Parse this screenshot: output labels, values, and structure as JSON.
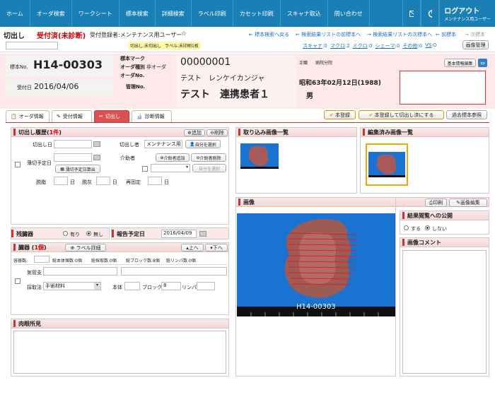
{
  "nav": {
    "items": [
      "ホーム",
      "オーダ検索",
      "ワークシート",
      "標本検索",
      "詳細検索",
      "ラベル印刷",
      "カセット印刷",
      "スキャナ取込",
      "問い合わせ"
    ],
    "logout": "ログアウト",
    "user": "メンテナンス用ユーザー"
  },
  "header": {
    "title": "切出し",
    "status": "受付済(未診断)",
    "registrant": "受付登録者:メンテナンス用ユーザー",
    "star": "☆",
    "links": [
      "標本検索へ戻る",
      "検索結果リストの前標本へ",
      "検索結果リストの次標本へ",
      "前標本",
      "次標本"
    ],
    "badge_cut": "切出し:未切出し",
    "badge_label": "ラベル:未印刷1枚",
    "counters": [
      {
        "k": "スキャナ",
        "v": "0"
      },
      {
        "k": "マクロ",
        "v": "2"
      },
      {
        "k": "ミクロ",
        "v": "0"
      },
      {
        "k": "シェーマ",
        "v": "0"
      },
      {
        "k": "その他",
        "v": "0"
      },
      {
        "k": "VS",
        "v": "0"
      }
    ],
    "image_mgmt": "画像管理"
  },
  "patient": {
    "specimen_label": "標本No.",
    "specimen_no": "H14-00303",
    "recv_label": "受付日",
    "recv_date": "2016/04/06",
    "mark_label": "標本マーク",
    "order_type_label": "オーダ種別",
    "order_type": "非オーダ",
    "order_no_label": "オーダNo.",
    "mgmt_label": "管理No.",
    "patient_id": "00000001",
    "kana": "テスト　レンケイカンジャ",
    "name": "テスト　連携患者１",
    "ward_label": "正職",
    "ward": "病院分院",
    "birth": "昭和63年02月12日(1988)",
    "sex": "男",
    "basic_edit": "基本情報編集"
  },
  "tabs": [
    "オーダ情報",
    "受付情報",
    "切出し",
    "診断情報"
  ],
  "actions": {
    "register": "本登録",
    "register_cut": "本登録して切出し済にする",
    "past": "過去標本参照"
  },
  "cut": {
    "title": "切出し履歴(",
    "count": "1件",
    "title_end": ")",
    "add": "追加",
    "del": "削除",
    "date_label": "切出し日",
    "cutter_label": "切出し者",
    "cutter": "メンテナンス用",
    "self_select": "自分を選択",
    "thin_label": "薄切予定日",
    "assist_label": "介助者",
    "assist_add": "介助者追加",
    "assist_del": "介助者削除",
    "assist_self": "自分を選択",
    "calc": "薄切予定日算出",
    "decal_label": "脱脂",
    "decal2_label": "脱灰",
    "refix_label": "再固定",
    "day": "日"
  },
  "residual": {
    "title": "残臓器",
    "opt1": "有り",
    "opt2": "無し",
    "selected": "無し"
  },
  "report": {
    "title": "報告予定日",
    "date": "2016/04/09"
  },
  "organ": {
    "title": "臓器 (",
    "count": "1個",
    "title_end": ")",
    "label_detail": "ラベル詳細",
    "up": "上へ",
    "down": "下へ",
    "container_label": "容器数:",
    "block_total": "総本体個数:0個",
    "cut_count": "総採取数:0個",
    "block_count": "総ブロック数:8個",
    "rinpa": "総リンパ数:0個",
    "organ_label": "気管支",
    "method_label": "採取法",
    "method": "手術材料",
    "body_label": "本体",
    "block_label": "ブロック",
    "block_val": "8",
    "lymph_label": "リンパ"
  },
  "macro": {
    "title": "肉眼所見"
  },
  "images": {
    "list_title": "取り込み画像一覧",
    "edited_title": "編集済み画像一覧",
    "image_title": "画像",
    "print": "印刷",
    "edit": "画像編集",
    "specimen_text": "H14-00303"
  },
  "publish": {
    "title": "結果閲覧への公開",
    "opt1": "する",
    "opt2": "しない",
    "selected": "しない"
  },
  "comment": {
    "title": "画像コメント"
  },
  "colors": {
    "nav": "#1a7fb5",
    "accent": "#d95252",
    "pink": "#fde9e9",
    "photo_bg": "#1b73d1"
  }
}
